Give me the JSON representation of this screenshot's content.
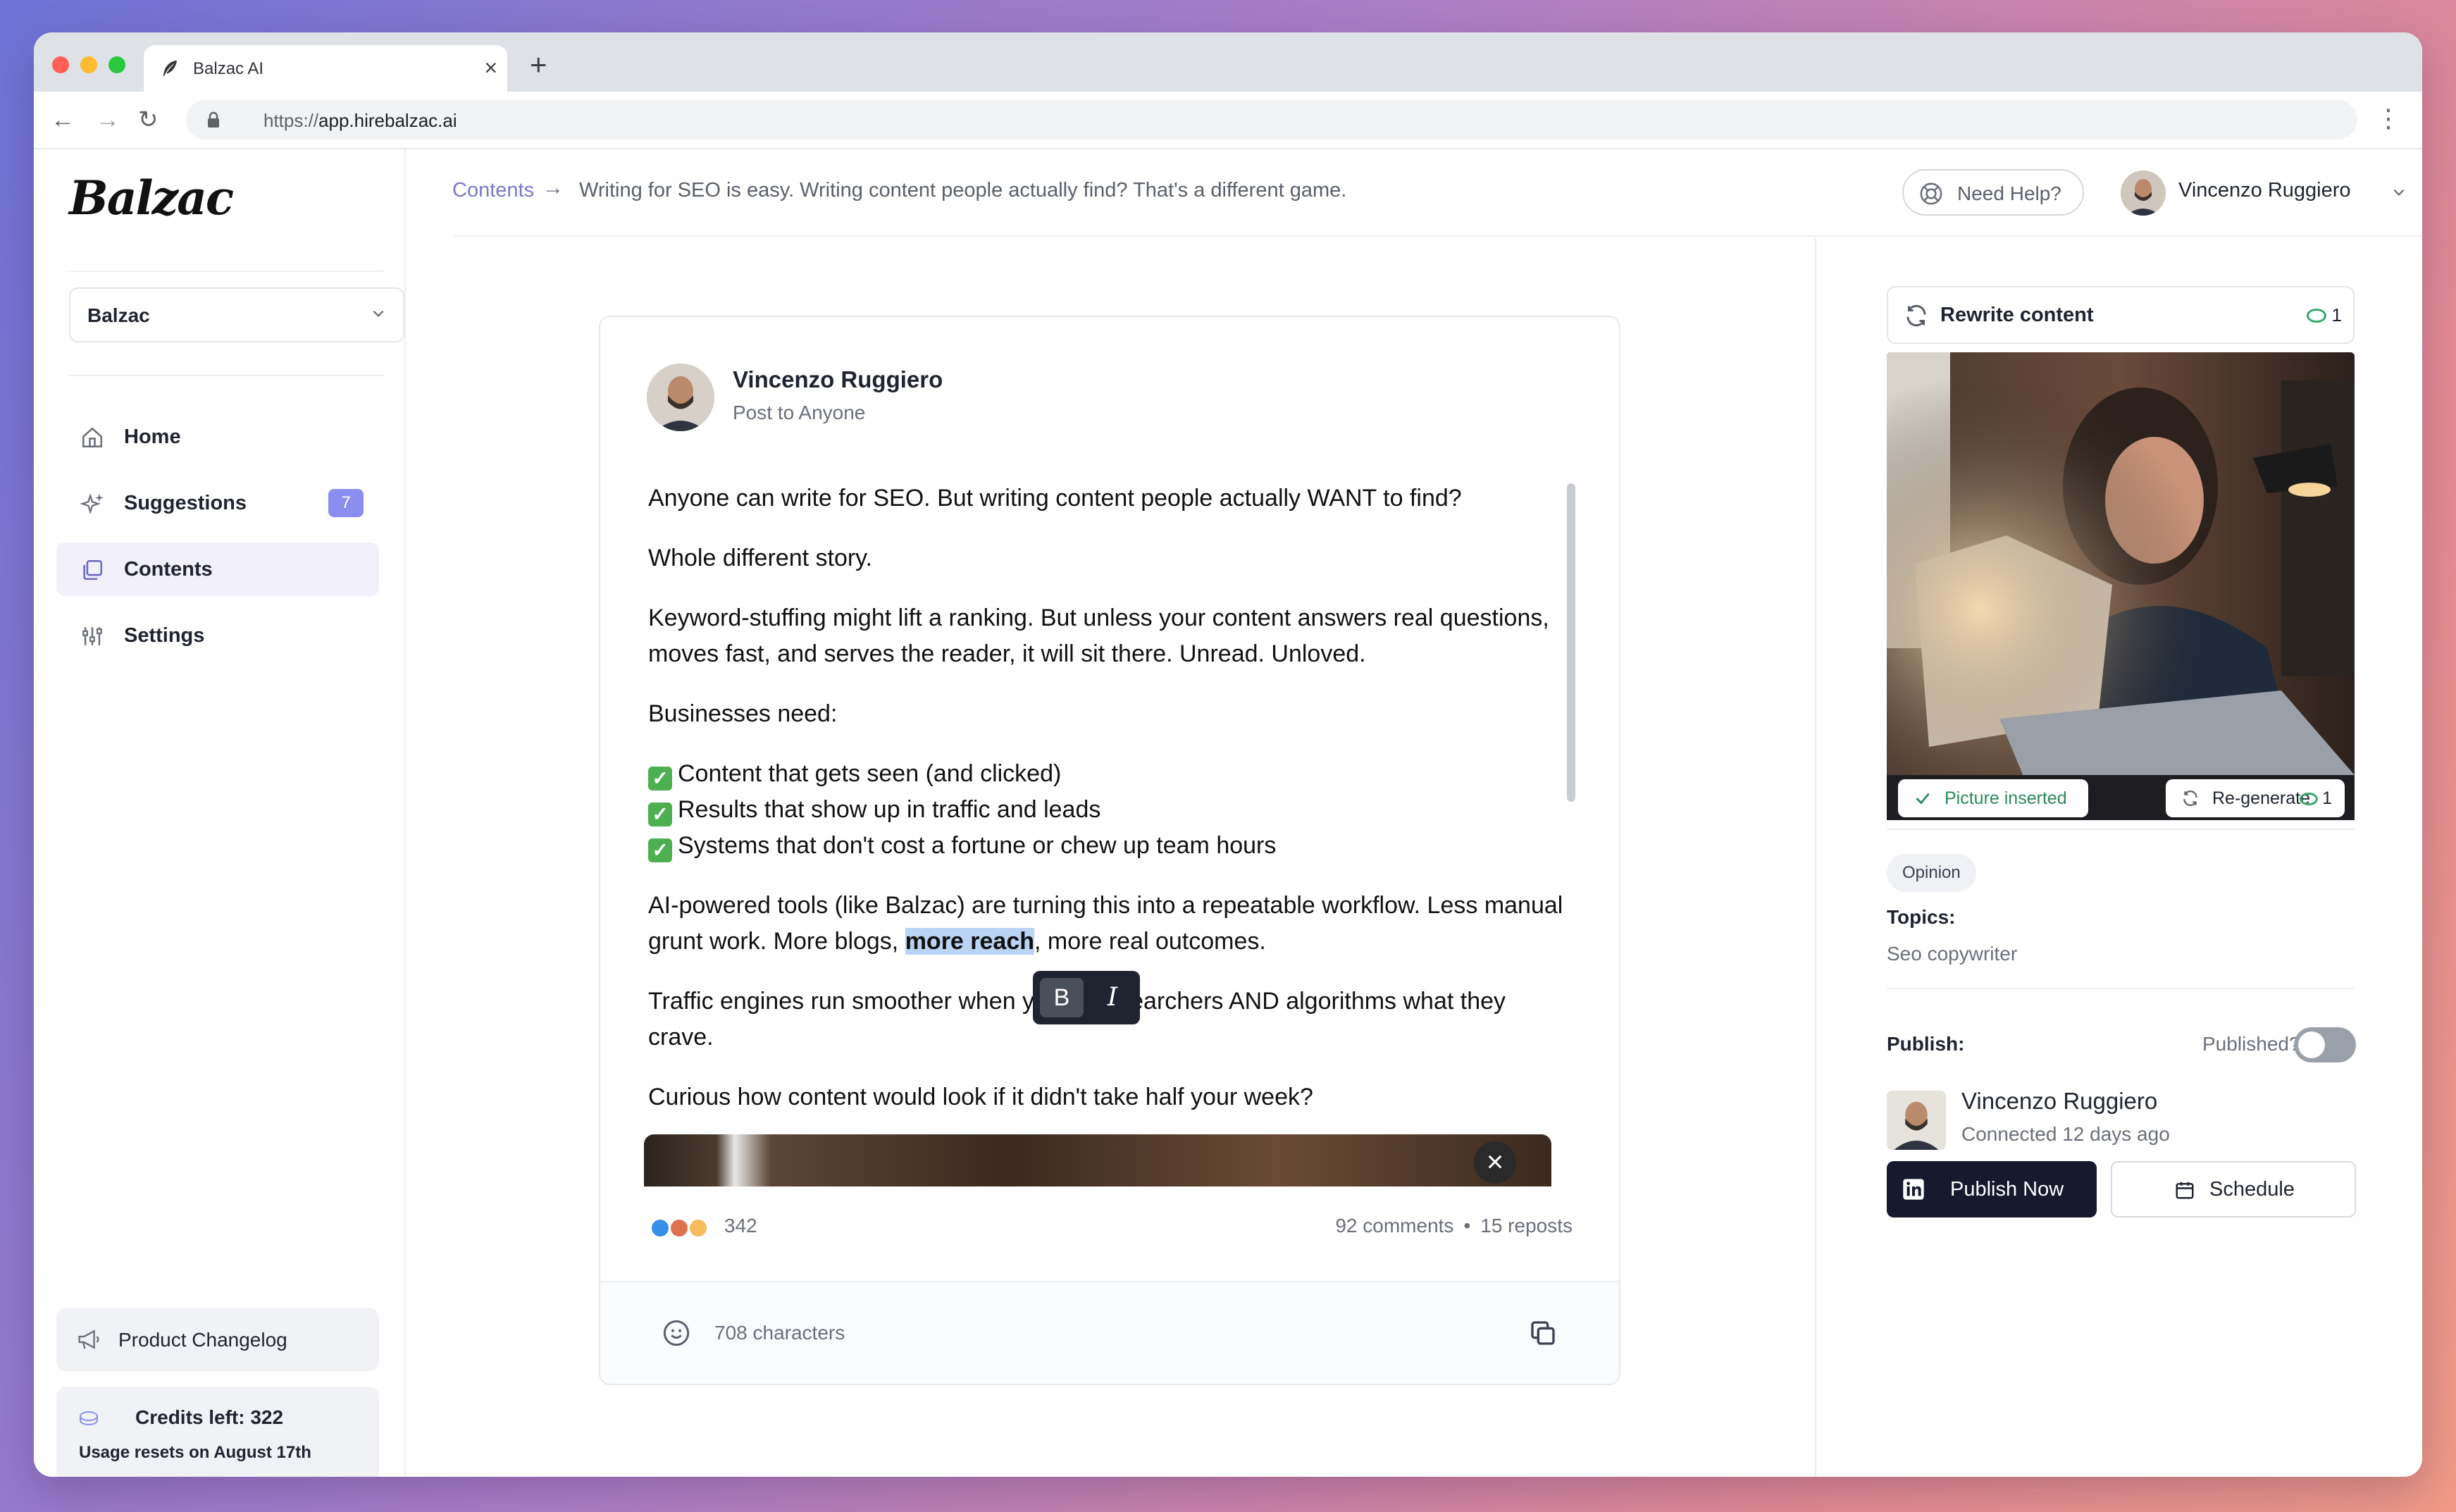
{
  "browser": {
    "tab_title": "Balzac AI",
    "url_scheme": "https://",
    "url_host": "app.hirebalzac.ai"
  },
  "sidebar": {
    "logo": "Balzac",
    "workspace": "Balzac",
    "items": [
      {
        "label": "Home",
        "icon": "home-icon"
      },
      {
        "label": "Suggestions",
        "icon": "sparkles-icon",
        "badge": "7"
      },
      {
        "label": "Contents",
        "icon": "documents-icon",
        "active": true
      },
      {
        "label": "Settings",
        "icon": "sliders-icon"
      }
    ],
    "changelog": "Product Changelog",
    "credits_title": "Credits left: 322",
    "credits_sub": "Usage resets on August 17th"
  },
  "header": {
    "crumb_link": "Contents",
    "crumb_arrow": "→",
    "crumb_current": "Writing for SEO is easy. Writing content people actually find? That's a different game.",
    "help": "Need Help?",
    "user": "Vincenzo Ruggiero"
  },
  "post": {
    "author": "Vincenzo Ruggiero",
    "audience": "Post to Anyone",
    "p1": "Anyone can write for SEO. But writing content people actually WANT to find?",
    "p2": "Whole different story.",
    "p3": "Keyword-stuffing might lift a ranking. But unless your content answers real questions, moves fast, and serves the reader, it will sit there. Unread. Unloved.",
    "p4": "Businesses need:",
    "checks": [
      "Content that gets seen (and clicked)",
      "Results that show up in traffic and leads",
      "Systems that don't cost a fortune or chew up team hours"
    ],
    "p5_a": "AI-powered tools (like Balzac) are turning this into a repeatable workflow. Less manual grunt work. More blogs, ",
    "p5_highlight": "more reach",
    "p5_b": ", more real outcomes.",
    "p6": "Traffic engines run smoother when you give searchers AND algorithms what they crave.",
    "p7": "Curious how content would look if it didn't take half your week?",
    "reactions": "342",
    "comments": "92 comments",
    "dot": "•",
    "reposts": "15 reposts",
    "characters": "708 characters",
    "format_bold": "B",
    "format_italic": "I"
  },
  "panel": {
    "rewrite": "Rewrite content",
    "rewrite_cost": "1",
    "picture_inserted": "Picture inserted",
    "regenerate": "Re-generate",
    "regenerate_cost": "1",
    "tag": "Opinion",
    "topics_label": "Topics:",
    "topics_value": "Seo copywriter",
    "publish_label": "Publish:",
    "published_q": "Published?",
    "published": false,
    "account_name": "Vincenzo Ruggiero",
    "account_status": "Connected 12 days ago",
    "publish_now": "Publish Now",
    "schedule": "Schedule"
  },
  "colors": {
    "accent": "#8b8ef0",
    "primary_button": "#161a2c",
    "breadcrumb_link": "#7b78c9",
    "highlight": "#b9d4f4"
  }
}
